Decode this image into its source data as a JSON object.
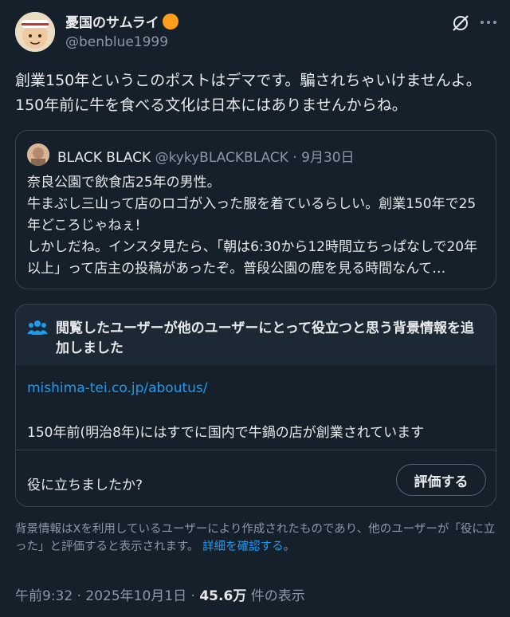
{
  "author": {
    "display_name": "憂国のサムライ",
    "handle": "@benblue1999",
    "badge_color": "#ff9e1b"
  },
  "post": {
    "text": "創業150年というこのポストはデマです。騙されちゃいけませんよ。\n150年前に牛を食べる文化は日本にはありませんからね。"
  },
  "quote": {
    "name": "BLACK BLACK",
    "handle": "@kykyBLACKBLACK",
    "separator": " · ",
    "date": "9月30日",
    "text": "奈良公園で飲食店25年の男性。\n牛まぶし三山って店のロゴが入った服を着ているらしい。創業150年で25年どころじゃねぇ!\nしかしだね。インスタ見たら、「朝は6:30から12時間立ちっぱなしで20年以上」って店主の投稿があったぞ。普段公園の鹿を見る時間なんて…"
  },
  "note": {
    "title": "閲覧したユーザーが他のユーザーにとって役立つと思う背景情報を追加しました",
    "link": "mishima-tei.co.jp/aboutus/",
    "body": "150年前(明治8年)にはすでに国内で牛鍋の店が創業されています",
    "helpful_question": "役に立ちましたか?",
    "rate_button": "評価する"
  },
  "footnote": {
    "text": "背景情報はXを利用しているユーザーにより作成されたものであり、他のユーザーが「役に立った」と評価すると表示されます。",
    "link": "詳細を確認する",
    "end": "。"
  },
  "meta": {
    "time": "午前9:32",
    "sep1": " · ",
    "date": "2025年10月1日",
    "sep2": " · ",
    "views": "45.6万",
    "views_label": " 件の表示"
  },
  "colors": {
    "background": "#15202b",
    "link": "#1d9bf0",
    "muted": "#8b98a5"
  }
}
